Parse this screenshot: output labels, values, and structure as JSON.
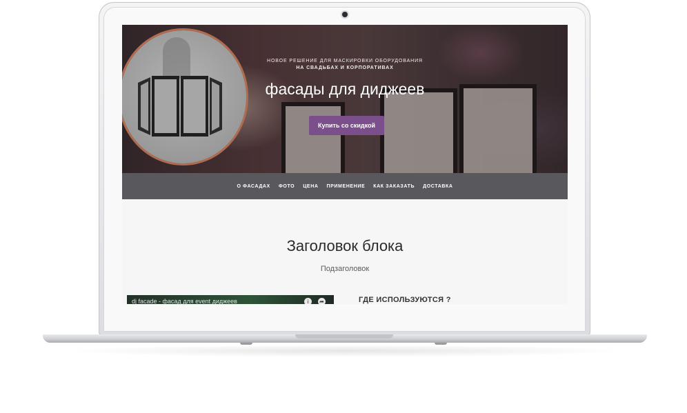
{
  "hero": {
    "kicker_line1": "НОВОЕ РЕШЕНИЕ ДЛЯ МАСКИРОВКИ ОБОРУДОВАНИЯ",
    "kicker_line2": "НА СВАДЬБАХ И КОРПОРАТИВАХ",
    "title": "фасады для диджеев",
    "cta_label": "Купить со скидкой"
  },
  "nav": {
    "items": [
      {
        "label": "О ФАСАДАХ"
      },
      {
        "label": "ФОТО"
      },
      {
        "label": "ЦЕНА"
      },
      {
        "label": "ПРИМЕНЕНИЕ"
      },
      {
        "label": "КАК ЗАКАЗАТЬ"
      },
      {
        "label": "ДОСТАВКА"
      }
    ]
  },
  "content": {
    "block_title": "Заголовок блока",
    "block_subtitle": "Подзаголовок",
    "video_title": "dj facade - фасад для event диджеев",
    "uses_heading": "ГДЕ ИСПОЛЬЗУЮТСЯ ?"
  },
  "colors": {
    "accent": "#7a4f8c",
    "nav_bg": "#58585d",
    "circle_ring": "#b16b4e"
  },
  "icons": [
    "camera-icon",
    "info-icon",
    "share-icon"
  ]
}
